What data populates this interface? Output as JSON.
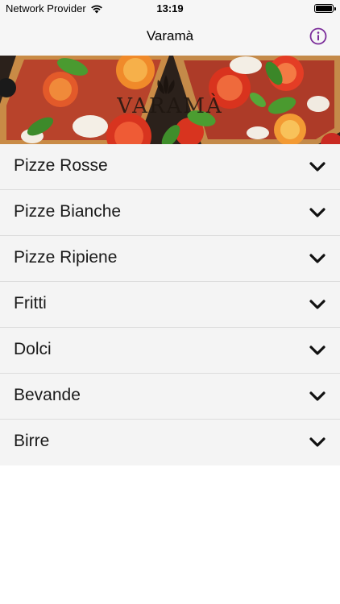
{
  "status_bar": {
    "carrier": "Network Provider",
    "time": "13:19"
  },
  "nav": {
    "title": "Varamà",
    "info_icon": "info-circle-icon",
    "accent_color": "#7b2d9a"
  },
  "hero": {
    "logo_text": "VARAMÀ"
  },
  "menu": {
    "items": [
      {
        "label": "Pizze Rosse"
      },
      {
        "label": "Pizze Bianche"
      },
      {
        "label": "Pizze Ripiene"
      },
      {
        "label": "Fritti"
      },
      {
        "label": "Dolci"
      },
      {
        "label": "Bevande"
      },
      {
        "label": "Birre"
      }
    ],
    "expand_icon": "chevron-down-icon"
  }
}
